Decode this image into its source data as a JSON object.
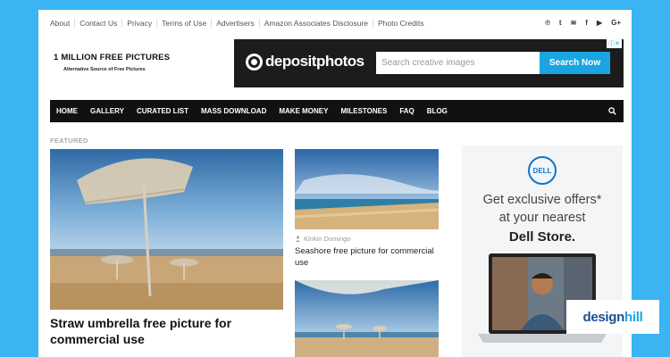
{
  "top_nav": [
    "About",
    "Contact Us",
    "Privacy",
    "Terms of Use",
    "Advertisers",
    "Amazon Associates Disclosure",
    "Photo Credits"
  ],
  "social_icons": [
    "pinterest-icon",
    "tumblr-icon",
    "rss-icon",
    "facebook-icon",
    "youtube-icon",
    "google-plus-icon"
  ],
  "social_glyphs": [
    "℗",
    "t",
    "≋",
    "f",
    "▶",
    "G+"
  ],
  "logo": {
    "title": "1 MILLION FREE PICTURES",
    "tagline": "Alternative Source of Free Pictures"
  },
  "ad_banner": {
    "brand": "depositphotos",
    "search_placeholder": "Search creative images",
    "search_button": "Search Now",
    "ad_choice": "ⓘ✕"
  },
  "main_nav": [
    "HOME",
    "GALLERY",
    "CURATED LIST",
    "MASS DOWNLOAD",
    "MAKE MONEY",
    "MILESTONES",
    "FAQ",
    "BLOG"
  ],
  "featured": {
    "label": "FEATURED",
    "main_post": {
      "title": "Straw umbrella free picture for commercial use"
    },
    "side_post": {
      "author": "Kinkin Domingo",
      "title": "Seashore free picture for commercial use"
    }
  },
  "side_ad": {
    "logo": "DELL",
    "line1": "Get exclusive offers*",
    "line2": "at your nearest",
    "line3": "Dell Store."
  },
  "watermark": {
    "part1": "design",
    "part2": "hill"
  },
  "colors": {
    "background": "#3ab4f2",
    "nav_bg": "#111111",
    "accent": "#1ba5e0"
  }
}
